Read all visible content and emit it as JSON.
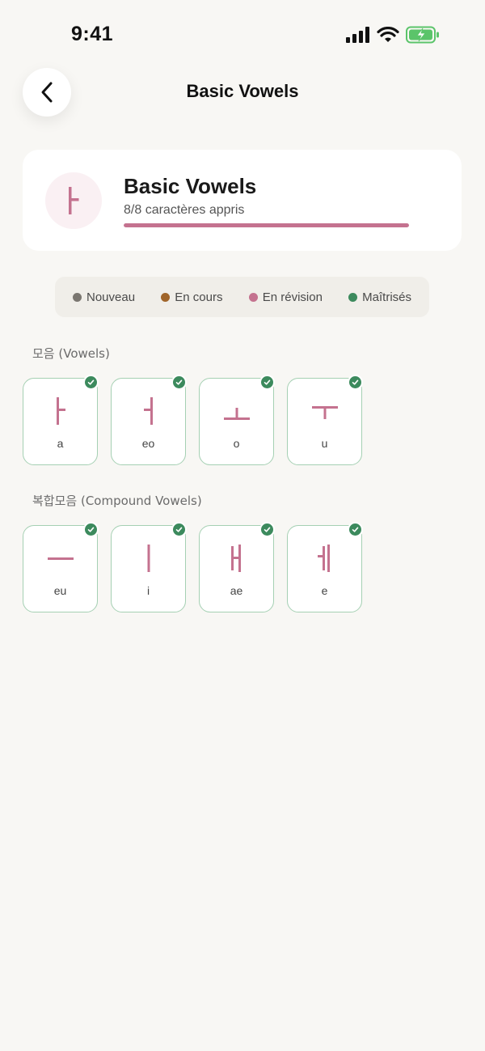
{
  "status_bar": {
    "time": "9:41",
    "signal_icon": "cellular-signal-icon",
    "wifi_icon": "wifi-icon",
    "battery_icon": "battery-charging-icon"
  },
  "header": {
    "title": "Basic Vowels",
    "back_icon": "chevron-left-icon"
  },
  "summary": {
    "title": "Basic Vowels",
    "glyph": "ㅏ",
    "progress_text": "8/8 caractères appris",
    "progress_fraction": 1.0
  },
  "legend": [
    {
      "label": "Nouveau",
      "color": "#7a7670"
    },
    {
      "label": "En cours",
      "color": "#a0652a"
    },
    {
      "label": "En révision",
      "color": "#c4728f"
    },
    {
      "label": "Maîtrisés",
      "color": "#3c8a5d"
    }
  ],
  "sections": [
    {
      "label": "모음 (Vowels)",
      "cards": [
        {
          "glyph": "ㅏ",
          "roman": "a",
          "status": "mastered"
        },
        {
          "glyph": "ㅓ",
          "roman": "eo",
          "status": "mastered"
        },
        {
          "glyph": "ㅗ",
          "roman": "o",
          "status": "mastered"
        },
        {
          "glyph": "ㅜ",
          "roman": "u",
          "status": "mastered"
        }
      ]
    },
    {
      "label": "복합모음 (Compound Vowels)",
      "cards": [
        {
          "glyph": "ㅡ",
          "roman": "eu",
          "status": "mastered"
        },
        {
          "glyph": "ㅣ",
          "roman": "i",
          "status": "mastered"
        },
        {
          "glyph": "ㅐ",
          "roman": "ae",
          "status": "mastered"
        },
        {
          "glyph": "ㅔ",
          "roman": "e",
          "status": "mastered"
        }
      ]
    }
  ],
  "colors": {
    "accent": "#c4728f",
    "mastered": "#3c8a5d",
    "card_border": "#a5d0b3",
    "background": "#f8f7f4"
  }
}
